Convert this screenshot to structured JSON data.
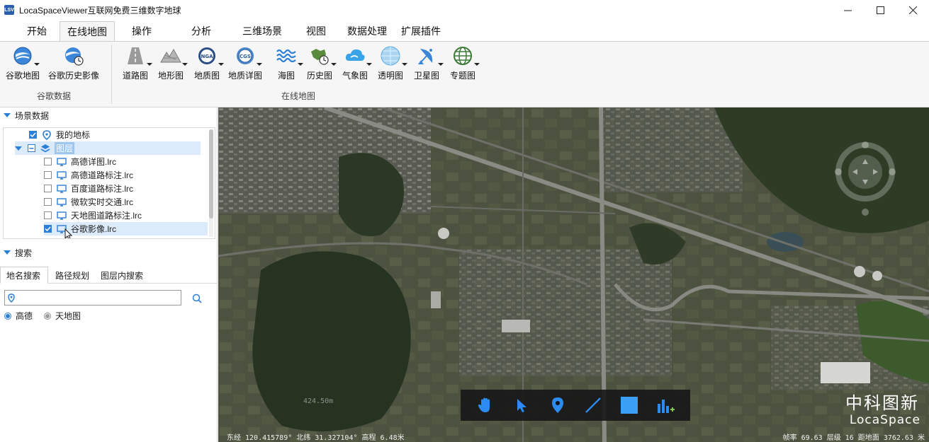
{
  "window": {
    "title": "LocaSpaceViewer互联网免费三维数字地球",
    "app_icon_text": "LSV"
  },
  "menu": {
    "tabs": [
      {
        "label": "开始"
      },
      {
        "label": "在线地图"
      },
      {
        "label": "操作"
      },
      {
        "label": "分析"
      },
      {
        "label": "三维场景"
      },
      {
        "label": "视图"
      },
      {
        "label": "数据处理"
      },
      {
        "label": "扩展插件"
      }
    ],
    "active_tab": "在线地图"
  },
  "ribbon": {
    "group_google": {
      "label": "谷歌数据",
      "buttons": [
        {
          "label": "谷歌地图",
          "icon": "google-earth-icon"
        },
        {
          "label": "谷歌历史影像",
          "icon": "google-history-icon"
        }
      ]
    },
    "group_online": {
      "label": "在线地图",
      "buttons": [
        {
          "label": "道路图",
          "icon": "road-icon"
        },
        {
          "label": "地形图",
          "icon": "terrain-icon"
        },
        {
          "label": "地质图",
          "icon": "nga-icon",
          "badge": "NGA"
        },
        {
          "label": "地质详图",
          "icon": "cgs-icon",
          "badge": "CGS"
        },
        {
          "label": "海图",
          "icon": "waves-icon"
        },
        {
          "label": "历史图",
          "icon": "history-map-icon"
        },
        {
          "label": "气象图",
          "icon": "weather-icon"
        },
        {
          "label": "透明图",
          "icon": "transparent-globe-icon"
        },
        {
          "label": "卫星图",
          "icon": "satellite-icon"
        },
        {
          "label": "专题图",
          "icon": "thematic-globe-icon"
        }
      ]
    },
    "colors": {
      "accent": "#2c7fd6"
    }
  },
  "scene_panel": {
    "title": "场景数据",
    "tree": [
      {
        "label": "我的地标",
        "checked": true,
        "icon": "placemark-icon"
      },
      {
        "label": "图层",
        "checked": "partial",
        "icon": "layers-icon",
        "selected": true
      },
      {
        "label": "高德详图.lrc",
        "checked": false,
        "icon": "monitor-icon"
      },
      {
        "label": "高德道路标注.lrc",
        "checked": false,
        "icon": "monitor-icon"
      },
      {
        "label": "百度道路标注.lrc",
        "checked": false,
        "icon": "monitor-icon"
      },
      {
        "label": "微软实时交通.lrc",
        "checked": false,
        "icon": "monitor-icon"
      },
      {
        "label": "天地图道路标注.lrc",
        "checked": false,
        "icon": "monitor-icon"
      },
      {
        "label": "谷歌影像.lrc",
        "checked": true,
        "icon": "monitor-icon",
        "hover": true
      }
    ]
  },
  "search_panel": {
    "title": "搜索",
    "tabs": [
      {
        "label": "地名搜索"
      },
      {
        "label": "路径规划"
      },
      {
        "label": "图层内搜索"
      }
    ],
    "active_tab": "地名搜索",
    "input": {
      "value": "",
      "placeholder": ""
    },
    "providers": [
      {
        "label": "高德",
        "selected": true
      },
      {
        "label": "天地图",
        "selected": false
      }
    ]
  },
  "map": {
    "scale_label": "424.50m",
    "tools": [
      {
        "name": "pan-tool",
        "icon": "hand-icon"
      },
      {
        "name": "select-tool",
        "icon": "arrow-icon"
      },
      {
        "name": "placemark-tool",
        "icon": "pin-icon"
      },
      {
        "name": "line-tool",
        "icon": "line-icon"
      },
      {
        "name": "polygon-tool",
        "icon": "square-icon"
      },
      {
        "name": "chart-tool",
        "icon": "bar-chart-icon"
      }
    ],
    "brand_cn": "中科图新",
    "brand_en": "LocaSpace",
    "status_left": "东经 120.415789°  北纬 31.327104°  高程 6.48米",
    "status_right": "帧率 69.63  层级 16  距地面 3762.63 米"
  }
}
